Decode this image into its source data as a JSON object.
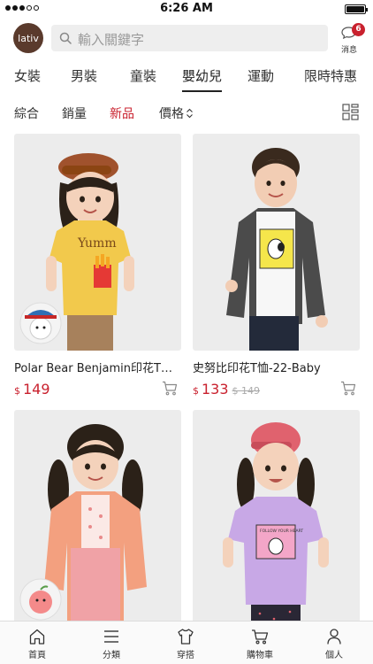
{
  "status": {
    "time": "6:26 AM"
  },
  "header": {
    "logo_text": "lativ",
    "search_placeholder": "輸入關鍵字",
    "messages_label": "消息",
    "messages_count": "6"
  },
  "categories": [
    {
      "label": "女裝",
      "active": false
    },
    {
      "label": "男裝",
      "active": false
    },
    {
      "label": "童裝",
      "active": false
    },
    {
      "label": "嬰幼兒",
      "active": true
    },
    {
      "label": "運動",
      "active": false
    },
    {
      "label": "限時特惠",
      "active": false
    }
  ],
  "sort": {
    "options": [
      {
        "label": "綜合",
        "active": false
      },
      {
        "label": "銷量",
        "active": false
      },
      {
        "label": "新品",
        "active": true
      },
      {
        "label": "價格",
        "active": false
      }
    ]
  },
  "products": [
    {
      "name": "Polar Bear Benjamin印花T恤-...",
      "currency": "$",
      "price": "149",
      "old_price": "",
      "shirt_color": "#f2c94c",
      "bg": "#e9e9e9"
    },
    {
      "name": "史努比印花T恤-22-Baby",
      "currency": "$",
      "price": "133",
      "old_price": "$ 149",
      "shirt_color": "#f7f7f7",
      "bg": "#ececec"
    },
    {
      "name": "",
      "currency": "",
      "price": "",
      "old_price": "",
      "shirt_color": "#f6c2a6",
      "bg": "#ececec"
    },
    {
      "name": "",
      "currency": "",
      "price": "",
      "old_price": "",
      "shirt_color": "#c8a8e6",
      "bg": "#ececec"
    }
  ],
  "bottom_nav": [
    {
      "label": "首頁",
      "icon": "home-icon"
    },
    {
      "label": "分類",
      "icon": "menu-icon"
    },
    {
      "label": "穿搭",
      "icon": "shirt-icon"
    },
    {
      "label": "購物車",
      "icon": "cart-icon"
    },
    {
      "label": "個人",
      "icon": "person-icon"
    }
  ],
  "colors": {
    "accent": "#c9212e",
    "logo_bg": "#5a3a2c"
  }
}
